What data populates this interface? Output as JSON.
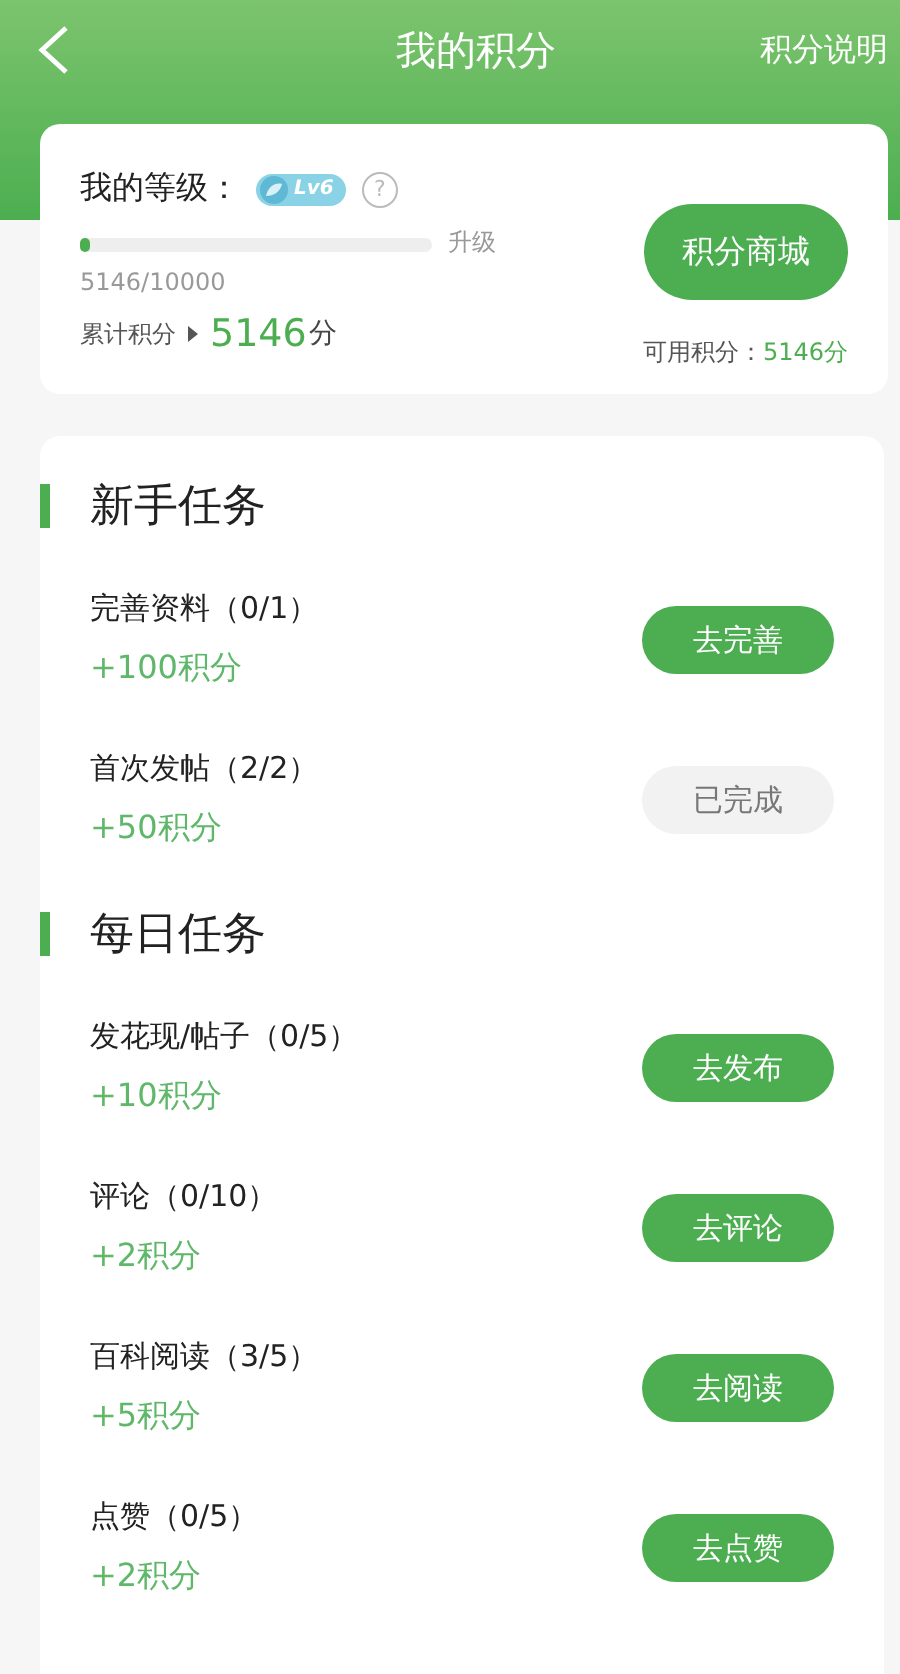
{
  "header": {
    "title": "我的积分",
    "action": "积分说明"
  },
  "summary": {
    "level_label": "我的等级：",
    "level_badge": "Lv6",
    "help": "?",
    "progress": {
      "level": 0.03,
      "label": "升级",
      "reading": "5146/10000"
    },
    "total_label": "累计积分",
    "total_value": "5146",
    "total_unit": "分",
    "mall_button": "积分商城",
    "available_label": "可用积分：",
    "available_value": "5146分"
  },
  "sections": [
    {
      "title": "新手任务",
      "tasks": [
        {
          "name": "完善资料（0/1）",
          "reward": "+100积分",
          "button": "去完善",
          "completed": false
        },
        {
          "name": "首次发帖（2/2）",
          "reward": "+50积分",
          "button": "已完成",
          "completed": true
        }
      ]
    },
    {
      "title": "每日任务",
      "tasks": [
        {
          "name": "发花现/帖子（0/5）",
          "reward": "+10积分",
          "button": "去发布",
          "completed": false
        },
        {
          "name": "评论（0/10）",
          "reward": "+2积分",
          "button": "去评论",
          "completed": false
        },
        {
          "name": "百科阅读（3/5）",
          "reward": "+5积分",
          "button": "去阅读",
          "completed": false
        },
        {
          "name": "点赞（0/5）",
          "reward": "+2积分",
          "button": "去点赞",
          "completed": false
        }
      ]
    }
  ]
}
